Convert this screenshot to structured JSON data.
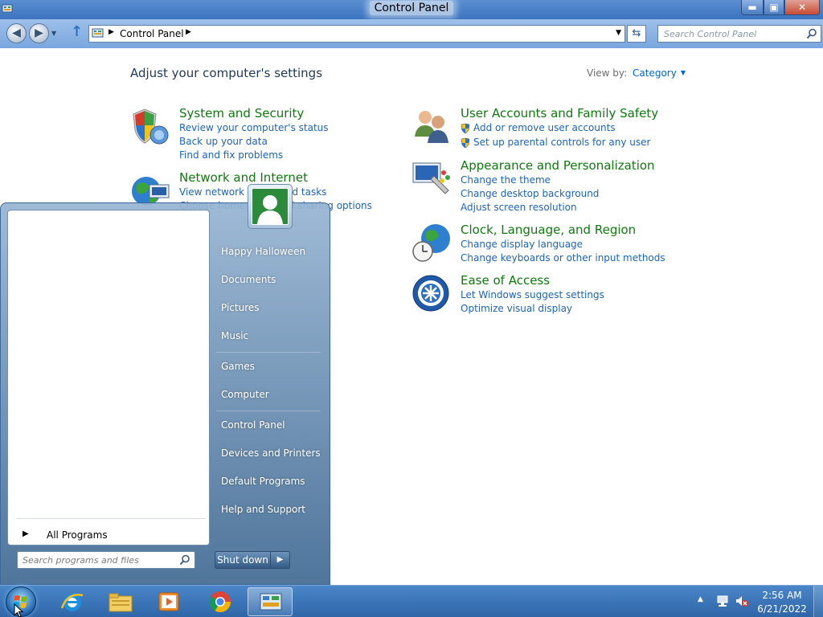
{
  "window": {
    "title": "Control Panel",
    "minimize": "▬",
    "maximize": "▣",
    "close": "✕"
  },
  "nav": {
    "breadcrumb": "Control Panel",
    "search_placeholder": "Search Control Panel"
  },
  "content": {
    "heading": "Adjust your computer's settings",
    "view_by_label": "View by:",
    "view_by_value": "Category"
  },
  "categories": [
    {
      "title": "System and Security",
      "icon": "shield-icon",
      "links": [
        "Review your computer's status",
        "Back up your data",
        "Find and fix problems"
      ]
    },
    {
      "title": "Network and Internet",
      "icon": "globe-network-icon",
      "links": [
        "View network status and tasks",
        "Choose homegroup and sharing options"
      ]
    },
    {
      "title": "User Accounts and Family Safety",
      "icon": "users-icon",
      "links": [
        "Add or remove user accounts",
        "Set up parental controls for any user"
      ]
    },
    {
      "title": "Appearance and Personalization",
      "icon": "monitor-paint-icon",
      "links": [
        "Change the theme",
        "Change desktop background",
        "Adjust screen resolution"
      ]
    },
    {
      "title": "Clock, Language, and Region",
      "icon": "globe-clock-icon",
      "links": [
        "Change display language",
        "Change keyboards or other input methods"
      ]
    },
    {
      "title": "Ease of Access",
      "icon": "ease-of-access-icon",
      "links": [
        "Let Windows suggest settings",
        "Optimize visual display"
      ]
    }
  ],
  "start_menu": {
    "all_programs": "All Programs",
    "search_placeholder": "Search programs and files",
    "right_items": [
      "Happy Halloween",
      "Documents",
      "Pictures",
      "Music",
      "Games",
      "Computer",
      "Control Panel",
      "Devices and Printers",
      "Default Programs",
      "Help and Support"
    ],
    "shutdown": "Shut down"
  },
  "taskbar": {
    "pinned": [
      "internet-explorer-icon",
      "file-explorer-icon",
      "media-player-icon",
      "chrome-icon",
      "control-panel-icon"
    ],
    "time": "2:56 AM",
    "date": "6/21/2022"
  },
  "colors": {
    "category_title": "#0e7a0d",
    "link": "#1e64b7",
    "heading": "#1e395b",
    "taskbar": "#2f66a8"
  }
}
